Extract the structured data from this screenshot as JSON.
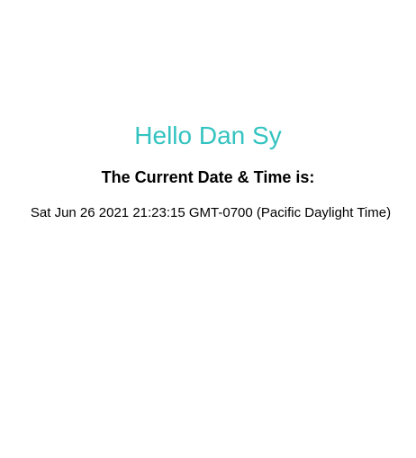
{
  "greeting": {
    "text": "Hello Dan Sy"
  },
  "subheading": {
    "text": "The Current Date & Time is:"
  },
  "datetime": {
    "value": "Sat Jun 26 2021 21:23:15 GMT-0700 (Pacific Daylight Time)"
  },
  "colors": {
    "greeting": "#33c3c0",
    "text": "#000000",
    "background": "#ffffff"
  }
}
